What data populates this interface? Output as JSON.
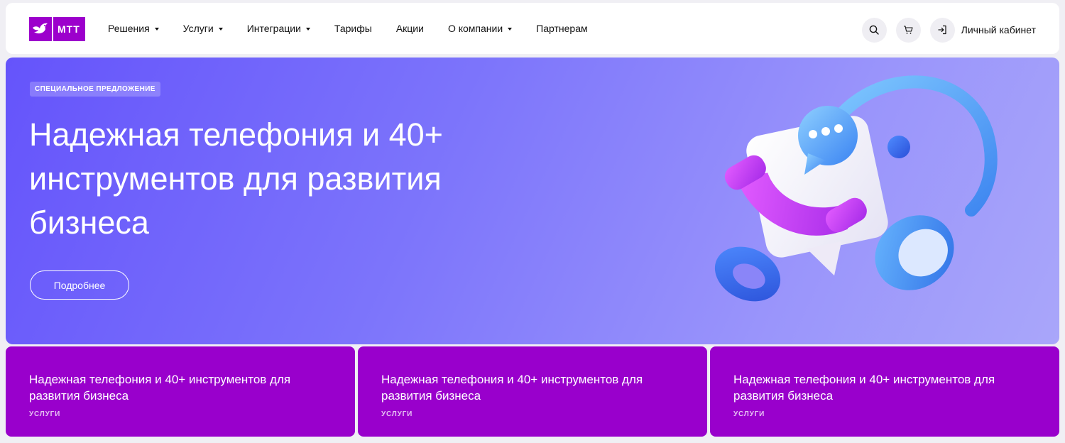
{
  "header": {
    "logo_text": "МТТ",
    "nav": [
      {
        "label": "Решения",
        "has_dropdown": true
      },
      {
        "label": "Услуги",
        "has_dropdown": true
      },
      {
        "label": "Интеграции",
        "has_dropdown": true
      },
      {
        "label": "Тарифы",
        "has_dropdown": false
      },
      {
        "label": "Акции",
        "has_dropdown": false
      },
      {
        "label": "О компании",
        "has_dropdown": true
      },
      {
        "label": "Партнерам",
        "has_dropdown": false
      }
    ],
    "search_icon": "search-icon",
    "cart_icon": "cart-icon",
    "login_icon": "login-icon",
    "cabinet_label": "Личный кабинет"
  },
  "hero": {
    "badge": "СПЕЦИАЛЬНОЕ ПРЕДЛОЖЕНИЕ",
    "title": "Надежная телефония и 40+ инструментов для развития бизнеса",
    "button_label": "Подробнее"
  },
  "cards": [
    {
      "title": "Надежная телефония и 40+ инструментов для развития бизнеса",
      "tag": "УСЛУГИ"
    },
    {
      "title": "Надежная телефония и 40+ инструментов для развития бизнеса",
      "tag": "УСЛУГИ"
    },
    {
      "title": "Надежная телефония и 40+ инструментов для развития бизнеса",
      "tag": "УСЛУГИ"
    }
  ],
  "colors": {
    "brand": "#9c00cc",
    "card_bg": "#9900cc",
    "hero_start": "#6554fb",
    "hero_end": "#a9a6fa"
  }
}
